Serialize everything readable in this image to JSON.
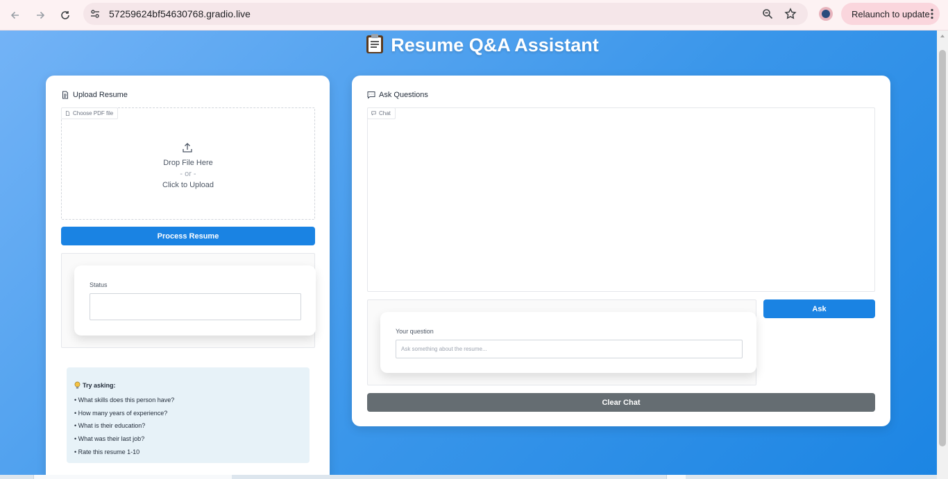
{
  "browser": {
    "url": "57259624bf54630768.gradio.live",
    "relaunch_label": "Relaunch to update",
    "icons": [
      "back-arrow-icon",
      "forward-arrow-icon",
      "reload-icon",
      "site-info-icon",
      "zoom-icon",
      "star-icon",
      "profile-avatar",
      "kebab-menu-icon"
    ]
  },
  "app": {
    "title": "Resume Q&A Assistant",
    "title_icon": "clipboard-icon",
    "accent_color": "#1a83e3",
    "secondary_color": "#656d72"
  },
  "upload": {
    "heading": "Upload Resume",
    "file_tag": "Choose PDF file",
    "drop_text": "Drop File Here",
    "or_text": "- or -",
    "click_text": "Click to Upload",
    "process_button": "Process Resume",
    "status_label": "Status",
    "status_value": ""
  },
  "tips": {
    "title": "Try asking:",
    "items": [
      "• What skills does this person have?",
      "• How many years of experience?",
      "• What is their education?",
      "• What was their last job?",
      "• Rate this resume 1-10"
    ]
  },
  "questions": {
    "heading": "Ask Questions",
    "chat_tag": "Chat",
    "question_label": "Your question",
    "question_placeholder": "Ask something about the resume...",
    "ask_button": "Ask",
    "clear_button": "Clear Chat"
  }
}
